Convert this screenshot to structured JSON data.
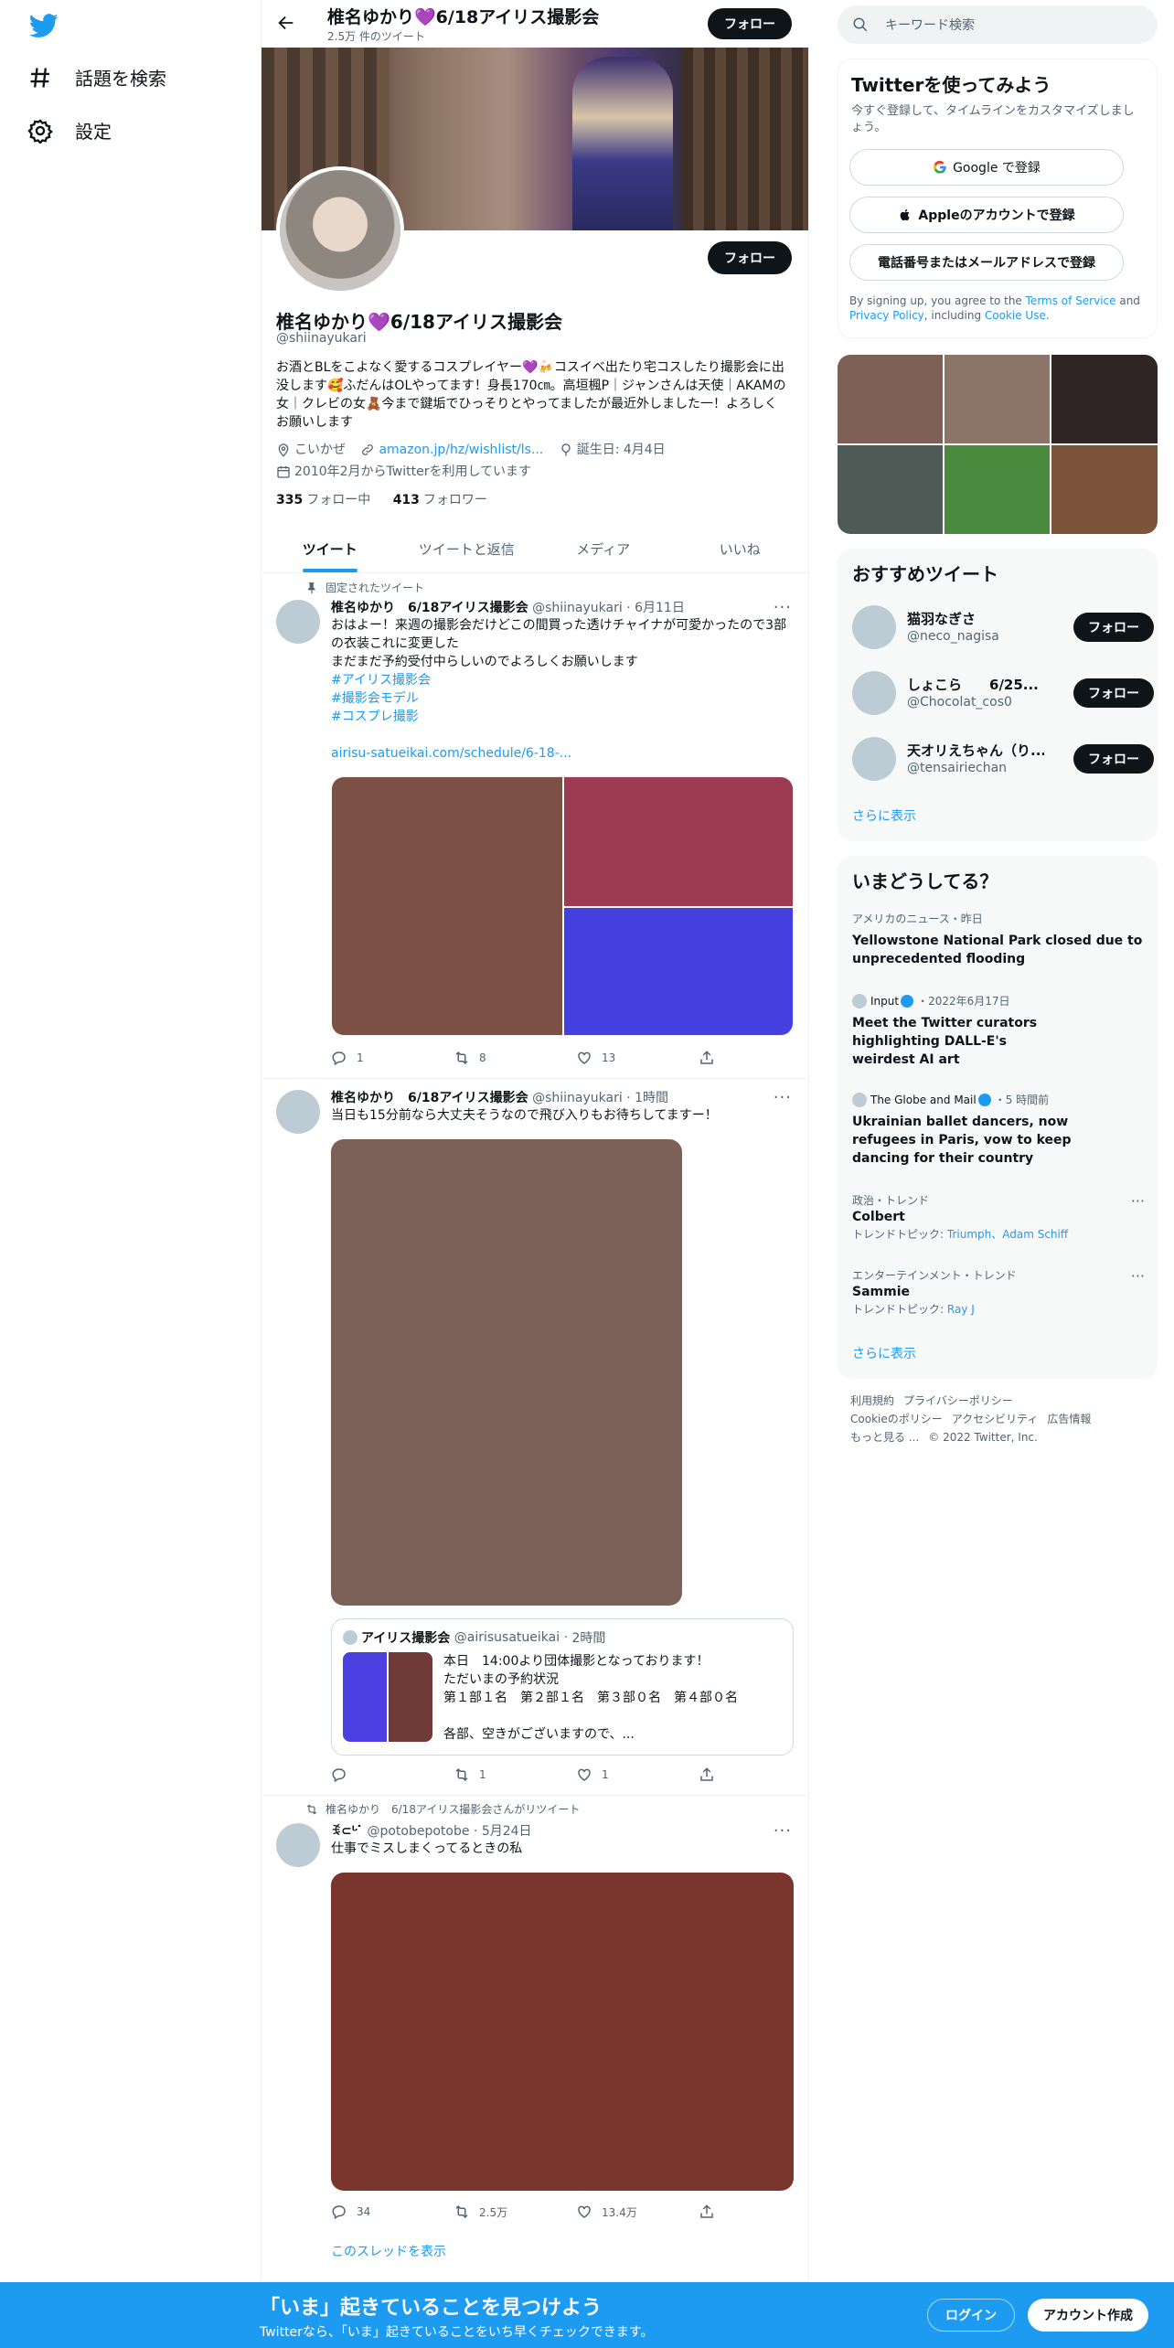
{
  "nav": {
    "explore": "話題を検索",
    "settings": "設定"
  },
  "header": {
    "name": "椎名ゆかり💜6/18アイリス撮影会",
    "tweet_count": "2.5万 件のツイート",
    "follow": "フォロー"
  },
  "profile": {
    "follow": "フォロー",
    "name": "椎名ゆかり💜6/18アイリス撮影会",
    "handle": "@shiinayukari",
    "bio": "お酒とBLをこよなく愛するコスプレイヤー💜🍻コスイベ出たり宅コスしたり撮影会に出没します🥰ふだんはOLやってます！身長170㎝。高垣楓P｜ジャンさんは天使｜AKAMの女｜クレビの女🧸今まで鍵垢でひっそりとやってましたが最近外しました一！よろしくお願いします",
    "location": "こいかぜ",
    "link": "amazon.jp/hz/wishlist/ls...",
    "birthday": "誕生日: 4月4日",
    "joined": "2010年2月からTwitterを利用しています",
    "following_count": "335",
    "following_label": "フォロー中",
    "followers_count": "413",
    "followers_label": "フォロワー"
  },
  "tabs": [
    "ツイート",
    "ツイートと返信",
    "メディア",
    "いいね"
  ],
  "tweets": [
    {
      "context": "固定されたツイート",
      "name": "椎名ゆかり　6/18アイリス撮影会",
      "handle": "@shiinayukari",
      "time": "6月11日",
      "text_lines": [
        "おはよー！来週の撮影会だけどこの間買った透けチャイナが可愛かったので3部の衣装これに変更した",
        "まだまだ予約受付中らしいのでよろしくお願いします"
      ],
      "hashtags": [
        "#アイリス撮影会",
        "#撮影会モデル",
        "#コスプレ撮影"
      ],
      "link": "airisu-satueikai.com/schedule/6-18-...",
      "colors": [
        "#7c5044",
        "#9c3b52",
        "#4440e0"
      ],
      "replies": "1",
      "retweets": "8",
      "likes": "13"
    },
    {
      "name": "椎名ゆかり　6/18アイリス撮影会",
      "handle": "@shiinayukari",
      "time": "1時間",
      "text": "当日も15分前なら大丈夫そうなので飛び入りもお待ちしてますー！",
      "image_color": "#7b6157",
      "quote": {
        "name": "アイリス撮影会",
        "handle": "@airisusatueikai",
        "time": "2時間",
        "lines": [
          "本日　14:00より団体撮影となっております！",
          "ただいまの予約状況",
          "第１部１名　第２部１名　第３部０名　第４部０名",
          "",
          "各部、空きがございますので、..."
        ],
        "colors": [
          "#4b3fe0",
          "#6f3a38"
        ]
      },
      "replies": "",
      "retweets": "1",
      "likes": "1"
    },
    {
      "context": "椎名ゆかり　6/18アイリス撮影会さんがリツイート",
      "name": "ꉂ⊂ᒡ ̇ ",
      "handle": "@potobepotobe",
      "time": "5月24日",
      "text": "仕事でミスしまくってるときの私",
      "image_color": "#7a352f",
      "replies": "34",
      "retweets": "2.5万",
      "likes": "13.4万",
      "show_thread": "このスレッドを表示"
    }
  ],
  "search": {
    "placeholder": "キーワード検索"
  },
  "signup": {
    "title": "Twitterを使ってみよう",
    "subtitle": "今すぐ登録して、タイムラインをカスタマイズしましょう。",
    "google": "Google で登録",
    "apple": "Appleのアカウントで登録",
    "phone": "電話番号またはメールアドレスで登録",
    "legal_1": "By signing up, you agree to the ",
    "terms": "Terms of Service",
    "legal_2": " and ",
    "privacy": "Privacy Policy",
    "legal_3": ", including ",
    "cookie": "Cookie Use",
    "legal_4": "."
  },
  "photos": [
    "#7d6157",
    "#8b7568",
    "#2f2625",
    "#4d5a55",
    "#4a8a3e",
    "#7d5439"
  ],
  "recommend": {
    "title": "おすすめツイート",
    "users": [
      {
        "name": "猫羽なぎさ",
        "handle": "@neco_nagisa",
        "follow": "フォロー"
      },
      {
        "name": "しょこら　　6/25...",
        "handle": "@Chocolat_cos0",
        "follow": "フォロー"
      },
      {
        "name": "天オリえちゃん（り...",
        "handle": "@tensairiechan",
        "follow": "フォロー"
      }
    ],
    "more": "さらに表示"
  },
  "trends": {
    "title": "いまどうしてる？",
    "items": [
      {
        "category": "アメリカのニュース・昨日",
        "title": "Yellowstone National Park closed due to unprecedented flooding"
      },
      {
        "source": "Input",
        "category": "・2022年6月17日",
        "title": "Meet the Twitter curators highlighting DALL-E's weirdest AI art"
      },
      {
        "source": "The Globe and Mail",
        "category": "・5 時間前",
        "title": "Ukrainian ballet dancers, now refugees in Paris, vow to keep dancing for their country"
      },
      {
        "category": "政治・トレンド",
        "title": "Colbert",
        "topics_label": "トレンドトピック:",
        "topics": "Triumph、Adam Schiff"
      },
      {
        "category": "エンターテインメント・トレンド",
        "title": "Sammie",
        "topics_label": "トレンドトピック:",
        "topics": "Ray J"
      }
    ],
    "more": "さらに表示"
  },
  "footer": {
    "links": [
      "利用規約",
      "プライバシーポリシー",
      "Cookieのポリシー",
      "アクセシビリティ",
      "広告情報",
      "もっと見る ...",
      "© 2022 Twitter, Inc."
    ]
  },
  "bottombar": {
    "title": "「いま」起きていることを見つけよう",
    "subtitle": "Twitterなら、「いま」起きていることをいち早くチェックできます。",
    "login": "ログイン",
    "signup": "アカウント作成"
  }
}
